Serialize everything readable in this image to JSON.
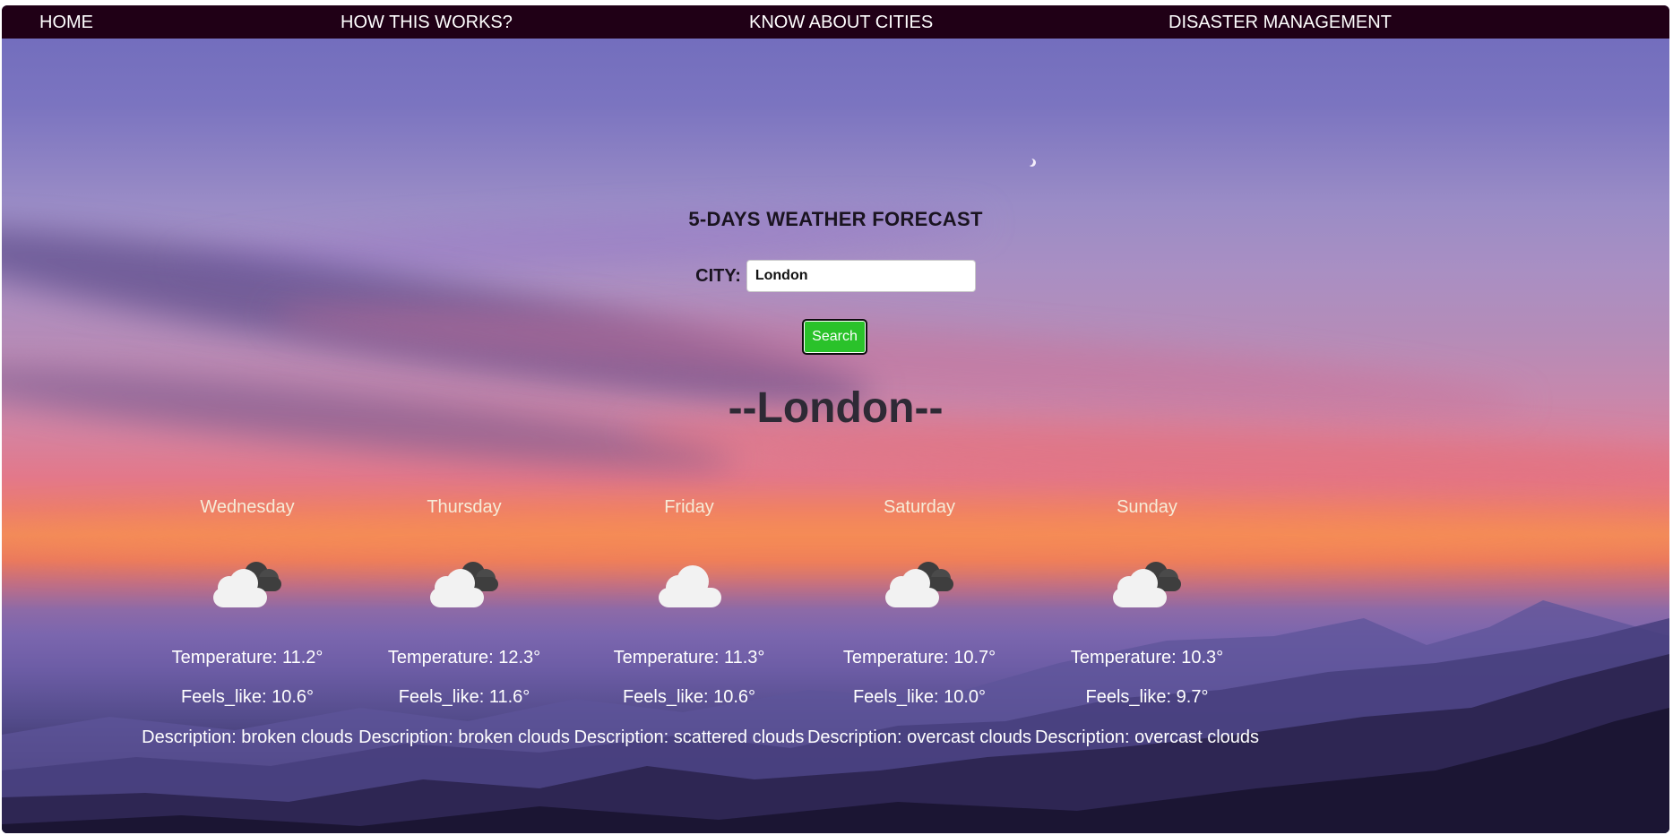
{
  "nav": {
    "home": "HOME",
    "how": "HOW THIS WORKS?",
    "cities": "KNOW ABOUT CITIES",
    "disaster": "DISASTER MANAGEMENT"
  },
  "form": {
    "title": "5-DAYS WEATHER FORECAST",
    "city_label": "CITY:",
    "city_value": "London",
    "search_label": "Search"
  },
  "result": {
    "city_heading": "--London--"
  },
  "days": [
    {
      "name": "Wednesday",
      "icon": "broken-clouds-icon",
      "temperature": "Temperature: 11.2°",
      "feels_like": "Feels_like: 10.6°",
      "description": "Description: broken clouds"
    },
    {
      "name": "Thursday",
      "icon": "broken-clouds-icon",
      "temperature": "Temperature: 12.3°",
      "feels_like": "Feels_like: 11.6°",
      "description": "Description: broken clouds"
    },
    {
      "name": "Friday",
      "icon": "scattered-clouds-icon",
      "temperature": "Temperature: 11.3°",
      "feels_like": "Feels_like: 10.6°",
      "description": "Description: scattered clouds"
    },
    {
      "name": "Saturday",
      "icon": "overcast-clouds-icon",
      "temperature": "Temperature: 10.7°",
      "feels_like": "Feels_like: 10.0°",
      "description": "Description: overcast clouds"
    },
    {
      "name": "Sunday",
      "icon": "overcast-clouds-icon",
      "temperature": "Temperature: 10.3°",
      "feels_like": "Feels_like: 9.7°",
      "description": "Description: overcast clouds"
    }
  ],
  "colors": {
    "navbar": "#200016",
    "search_button": "#2ac22a",
    "heading_text": "#2e2a35"
  }
}
